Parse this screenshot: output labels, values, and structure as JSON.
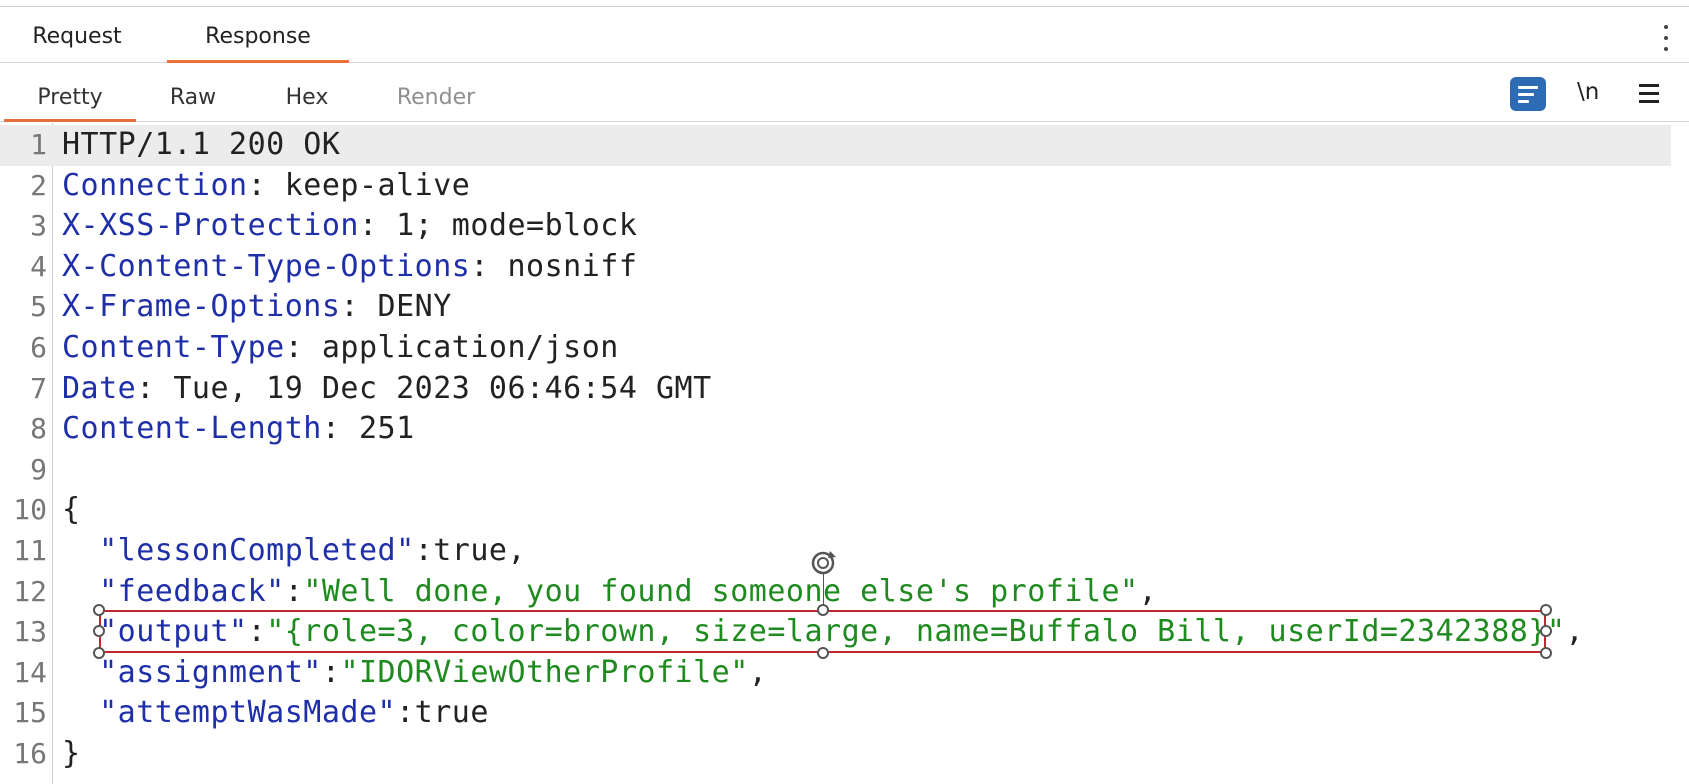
{
  "tabs": [
    {
      "label": "Request",
      "active": false
    },
    {
      "label": "Response",
      "active": true
    }
  ],
  "view_tabs": [
    {
      "label": "Pretty",
      "active": true
    },
    {
      "label": "Raw",
      "active": false
    },
    {
      "label": "Hex",
      "active": false
    },
    {
      "label": "Render",
      "active": false,
      "disabled": true
    }
  ],
  "toolbar": {
    "wrap_icon": "text-wrap-icon",
    "newline_label": "\\n",
    "menu_icon": "hamburger-menu-icon",
    "more_icon": "vertical-dots-icon",
    "accent_color": "#2d6bb5"
  },
  "colors": {
    "tab_underline": "#e8703a",
    "header_key": "#1f2fa8",
    "string_value": "#1f8a1f",
    "selection_border": "#c0262d"
  },
  "response": {
    "lines": [
      {
        "n": "1",
        "plain": "HTTP/1.1 200 OK"
      },
      {
        "n": "2",
        "key": "Connection",
        "val": ": keep-alive"
      },
      {
        "n": "3",
        "key": "X-XSS-Protection",
        "val": ": 1; mode=block"
      },
      {
        "n": "4",
        "key": "X-Content-Type-Options",
        "val": ": nosniff"
      },
      {
        "n": "5",
        "key": "X-Frame-Options",
        "val": ": DENY"
      },
      {
        "n": "6",
        "key": "Content-Type",
        "val": ": application/json"
      },
      {
        "n": "7",
        "key": "Date",
        "val": ": Tue, 19 Dec 2023 06:46:54 GMT"
      },
      {
        "n": "8",
        "key": "Content-Length",
        "val": ": 251"
      },
      {
        "n": "9",
        "plain": ""
      },
      {
        "n": "10",
        "plain": "{"
      },
      {
        "n": "11",
        "indent": "  ",
        "jkey": "\"lessonCompleted\"",
        "sep": ":",
        "jval": "true",
        "tail": ","
      },
      {
        "n": "12",
        "indent": "  ",
        "jkey": "\"feedback\"",
        "sep": ":",
        "jstr": "\"Well done, you found someone else's profile\"",
        "tail": ","
      },
      {
        "n": "13",
        "indent": "  ",
        "jkey": "\"output\"",
        "sep": ":",
        "jstr": "\"{role=3, color=brown, size=large, name=Buffalo Bill, userId=2342388}\"",
        "tail": ","
      },
      {
        "n": "14",
        "indent": "  ",
        "jkey": "\"assignment\"",
        "sep": ":",
        "jstr": "\"IDORViewOtherProfile\"",
        "tail": ","
      },
      {
        "n": "15",
        "indent": "  ",
        "jkey": "\"attemptWasMade\"",
        "sep": ":",
        "jval": "true",
        "tail": ""
      },
      {
        "n": "16",
        "plain": "}"
      }
    ]
  }
}
